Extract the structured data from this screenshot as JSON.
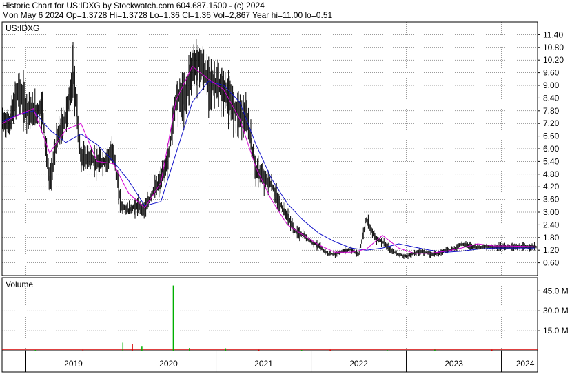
{
  "header": {
    "line1": "Historic Chart for US:IDXG by Stockwatch.com 604.687.1500 - (c) 2024",
    "line2": "Mon May  6 2024  Op=1.3728  Hi=1.3728  Lo=1.36  Cl=1.36  Vol=2,867  Year hi=11.00  lo=0.51"
  },
  "colors": {
    "price": "#000000",
    "ma_short": "#d400d4",
    "ma_long": "#1010c8",
    "volume_up": "#00b000",
    "volume_down": "#d40000",
    "grid": "#000000"
  },
  "chart_data": [
    {
      "type": "line",
      "title": "US:IDXG",
      "ylim": [
        0,
        12
      ],
      "y_ticks": [
        "0.60",
        "1.20",
        "1.80",
        "2.40",
        "3.00",
        "3.60",
        "4.20",
        "4.80",
        "5.40",
        "6.00",
        "6.60",
        "7.20",
        "7.80",
        "8.40",
        "9.00",
        "9.60",
        "10.20",
        "10.80",
        "11.40"
      ],
      "year_hi": 11.0,
      "year_lo": 0.51,
      "series": [
        {
          "key": "price",
          "x": [
            2018.75,
            2018.83,
            2018.92,
            2019.0,
            2019.08,
            2019.17,
            2019.25,
            2019.33,
            2019.42,
            2019.5,
            2019.58,
            2019.67,
            2019.75,
            2019.83,
            2019.92,
            2020.0,
            2020.08,
            2020.17,
            2020.25,
            2020.33,
            2020.42,
            2020.5,
            2020.58,
            2020.67,
            2020.75,
            2020.83,
            2020.92,
            2021.0,
            2021.08,
            2021.17,
            2021.25,
            2021.33,
            2021.42,
            2021.5,
            2021.58,
            2021.67,
            2021.75,
            2021.83,
            2021.92,
            2022.0,
            2022.08,
            2022.17,
            2022.25,
            2022.33,
            2022.42,
            2022.5,
            2022.58,
            2022.67,
            2022.75,
            2022.83,
            2022.92,
            2023.0,
            2023.08,
            2023.17,
            2023.25,
            2023.33,
            2023.42,
            2023.5,
            2023.58,
            2023.67,
            2023.75,
            2023.83,
            2023.92,
            2024.0,
            2024.08,
            2024.17,
            2024.25,
            2024.35
          ],
          "values": [
            7.3,
            7.2,
            8.8,
            8.0,
            7.6,
            8.0,
            4.3,
            6.5,
            7.5,
            9.6,
            5.5,
            5.6,
            5.3,
            5.4,
            5.9,
            3.3,
            3.1,
            3.3,
            3.1,
            3.9,
            4.5,
            5.6,
            8.5,
            8.4,
            9.9,
            10.1,
            9.2,
            9.0,
            8.8,
            8.0,
            7.7,
            7.3,
            5.0,
            4.6,
            4.3,
            3.4,
            2.8,
            2.1,
            1.9,
            1.6,
            1.4,
            1.05,
            1.0,
            1.15,
            1.25,
            0.95,
            2.7,
            1.8,
            1.6,
            1.2,
            1.0,
            0.9,
            1.05,
            1.15,
            1.0,
            1.05,
            1.2,
            1.25,
            1.5,
            1.4,
            1.35,
            1.36,
            1.36,
            1.36,
            1.36,
            1.36,
            1.36,
            1.36
          ]
        },
        {
          "key": "ma_short",
          "x": [
            2018.75,
            2018.92,
            2019.08,
            2019.25,
            2019.42,
            2019.58,
            2019.75,
            2019.92,
            2020.08,
            2020.25,
            2020.42,
            2020.58,
            2020.75,
            2020.92,
            2021.08,
            2021.25,
            2021.42,
            2021.58,
            2021.75,
            2021.92,
            2022.08,
            2022.25,
            2022.42,
            2022.58,
            2022.75,
            2022.92,
            2023.08,
            2023.25,
            2023.42,
            2023.58,
            2023.75,
            2023.92,
            2024.08,
            2024.25,
            2024.35
          ],
          "values": [
            7.2,
            7.6,
            7.9,
            5.8,
            6.9,
            7.2,
            5.4,
            5.3,
            3.9,
            3.2,
            4.4,
            8.3,
            9.9,
            9.3,
            8.8,
            7.4,
            5.1,
            3.6,
            2.4,
            1.9,
            1.45,
            1.1,
            1.1,
            1.25,
            1.9,
            1.3,
            1.05,
            1.05,
            1.15,
            1.3,
            1.5,
            1.4,
            1.4,
            1.38,
            1.36
          ]
        },
        {
          "key": "ma_long",
          "x": [
            2018.75,
            2018.92,
            2019.08,
            2019.25,
            2019.42,
            2019.58,
            2019.75,
            2019.92,
            2020.08,
            2020.25,
            2020.42,
            2020.58,
            2020.75,
            2020.92,
            2021.08,
            2021.25,
            2021.42,
            2021.58,
            2021.75,
            2021.92,
            2022.08,
            2022.25,
            2022.42,
            2022.58,
            2022.75,
            2022.92,
            2023.08,
            2023.25,
            2023.42,
            2023.58,
            2023.75,
            2023.92,
            2024.08,
            2024.25,
            2024.35
          ],
          "values": [
            7.3,
            7.6,
            7.8,
            6.9,
            6.3,
            6.7,
            6.2,
            5.4,
            4.5,
            3.3,
            3.5,
            5.8,
            8.2,
            9.2,
            9.0,
            8.2,
            6.2,
            4.6,
            3.4,
            2.6,
            2.0,
            1.6,
            1.3,
            1.2,
            1.3,
            1.5,
            1.35,
            1.2,
            1.1,
            1.15,
            1.25,
            1.3,
            1.3,
            1.3,
            1.3
          ]
        }
      ],
      "x_tick_labels": [
        "2019",
        "2020",
        "2021",
        "2022",
        "2023",
        "2024"
      ],
      "x_tick_values": [
        2019.5,
        2020.5,
        2021.5,
        2022.5,
        2023.5,
        2024.25
      ]
    },
    {
      "type": "bar",
      "title": "Volume",
      "ylim": [
        0,
        55
      ],
      "y_ticks": [
        "15.0 M",
        "30.0 M",
        "45.0 M"
      ],
      "x": [
        2019.1,
        2019.6,
        2020.02,
        2020.12,
        2020.22,
        2020.55,
        2020.72,
        2021.1,
        2021.45,
        2021.9,
        2022.2,
        2022.8,
        2023.3,
        2023.9
      ],
      "values": [
        0.5,
        0.6,
        6.0,
        5.0,
        3.0,
        49.0,
        2.0,
        1.8,
        0.6,
        0.5,
        0.6,
        0.5,
        0.7,
        0.6
      ],
      "direction": [
        "up",
        "down",
        "up",
        "down",
        "up",
        "up",
        "up",
        "up",
        "down",
        "up",
        "down",
        "up",
        "up",
        "down"
      ]
    }
  ]
}
